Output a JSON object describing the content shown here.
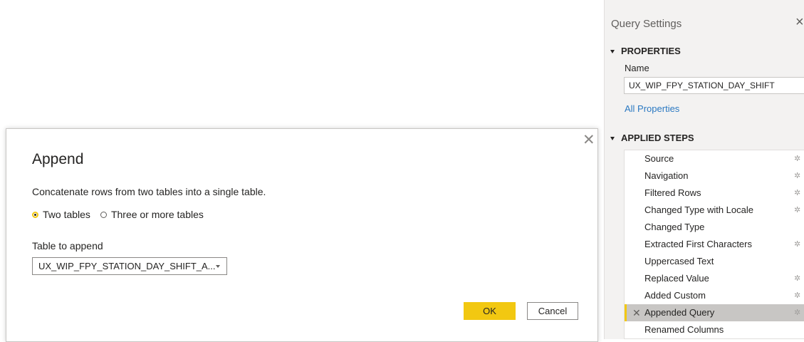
{
  "query_settings": {
    "title": "Query Settings",
    "close_glyph": "×",
    "properties": {
      "header": "PROPERTIES",
      "name_label": "Name",
      "name_value": "UX_WIP_FPY_STATION_DAY_SHIFT",
      "all_properties_link": "All Properties"
    },
    "applied_steps": {
      "header": "APPLIED STEPS",
      "steps": [
        {
          "label": "Source",
          "has_gear": true
        },
        {
          "label": "Navigation",
          "has_gear": true
        },
        {
          "label": "Filtered Rows",
          "has_gear": true
        },
        {
          "label": "Changed Type with Locale",
          "has_gear": true
        },
        {
          "label": "Changed Type",
          "has_gear": false
        },
        {
          "label": "Extracted First Characters",
          "has_gear": true
        },
        {
          "label": "Uppercased Text",
          "has_gear": false
        },
        {
          "label": "Replaced Value",
          "has_gear": true
        },
        {
          "label": "Added Custom",
          "has_gear": true
        },
        {
          "label": "Appended Query",
          "has_gear": true,
          "selected": true
        },
        {
          "label": "Renamed Columns",
          "has_gear": false
        }
      ],
      "gear_glyph": "✲",
      "delete_glyph": "✕"
    }
  },
  "dialog": {
    "title": "Append",
    "close_glyph": "✕",
    "description": "Concatenate rows from two tables into a single table.",
    "radio_options": [
      {
        "label": "Two tables",
        "selected": true
      },
      {
        "label": "Three or more tables",
        "selected": false
      }
    ],
    "table_to_append_label": "Table to append",
    "table_to_append_value": "UX_WIP_FPY_STATION_DAY_SHIFT_A...",
    "ok_label": "OK",
    "cancel_label": "Cancel"
  },
  "colors": {
    "accent": "#f2c811",
    "link": "#2b79c2",
    "selected_row": "#c8c6c4",
    "pane_bg": "#f3f2f1"
  }
}
